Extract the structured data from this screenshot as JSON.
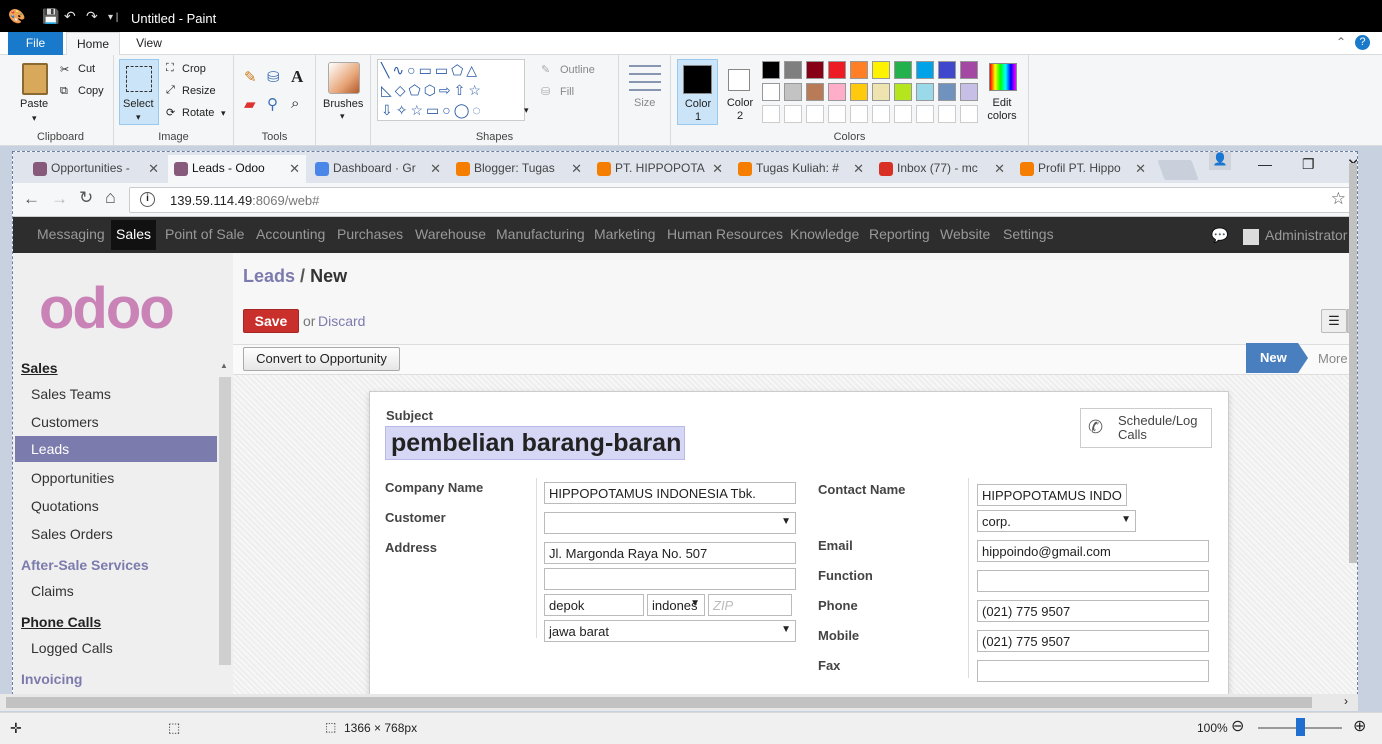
{
  "paint": {
    "title": "Untitled - Paint",
    "tabs": [
      "File",
      "Home",
      "View"
    ],
    "clipboard": {
      "paste": "Paste",
      "cut": "Cut",
      "copy": "Copy",
      "label": "Clipboard"
    },
    "image": {
      "select": "Select",
      "crop": "Crop",
      "resize": "Resize",
      "rotate": "Rotate",
      "label": "Image"
    },
    "tools": {
      "label": "Tools"
    },
    "brushes": "Brushes",
    "shapes": {
      "outline": "Outline",
      "fill": "Fill",
      "label": "Shapes"
    },
    "size": "Size",
    "color1": "Color 1",
    "color2": "Color 2",
    "colors_label": "Colors",
    "edit_colors": "Edit colors",
    "palette_row1": [
      "#000000",
      "#7f7f7f",
      "#880015",
      "#ed1c24",
      "#ff7f27",
      "#fff200",
      "#22b14c",
      "#00a2e8",
      "#3f48cc",
      "#a349a4"
    ],
    "palette_row2": [
      "#ffffff",
      "#c3c3c3",
      "#b97a57",
      "#ffaec9",
      "#ffc90e",
      "#efe4b0",
      "#b5e61d",
      "#99d9ea",
      "#7092be",
      "#c8bfe7"
    ],
    "status": {
      "dims": "1366 × 768px",
      "zoom": "100%"
    }
  },
  "browser": {
    "tabs": [
      {
        "label": "Opportunities -",
        "color": "#875a7b"
      },
      {
        "label": "Leads - Odoo",
        "color": "#875a7b"
      },
      {
        "label": "Dashboard · Gr",
        "color": "#4a86e8"
      },
      {
        "label": "Blogger: Tugas",
        "color": "#f57d00"
      },
      {
        "label": "PT. HIPPOPOTA",
        "color": "#f57d00"
      },
      {
        "label": "Tugas Kuliah: #",
        "color": "#f57d00"
      },
      {
        "label": "Inbox (77) - mc",
        "color": "#d93025"
      },
      {
        "label": "Profil PT. Hippo",
        "color": "#f57d00"
      }
    ],
    "url_host": "139.59.114.49",
    "url_rest": ":8069/web#"
  },
  "odoo": {
    "nav": [
      "Messaging",
      "Sales",
      "Point of Sale",
      "Accounting",
      "Purchases",
      "Warehouse",
      "Manufacturing",
      "Marketing",
      "Human Resources",
      "Knowledge",
      "Reporting",
      "Website",
      "Settings"
    ],
    "user": "Administrator",
    "logo": "odoo",
    "sidebar": {
      "sales": "Sales",
      "items": [
        "Sales Teams",
        "Customers",
        "Leads",
        "Opportunities",
        "Quotations",
        "Sales Orders"
      ],
      "after_sale": "After-Sale Services",
      "claims": "Claims",
      "phone_calls": "Phone Calls",
      "logged_calls": "Logged Calls",
      "invoicing": "Invoicing"
    },
    "breadcrumb_parent": "Leads",
    "breadcrumb_sep": "/",
    "breadcrumb_current": "New",
    "save": "Save",
    "or": "or",
    "discard": "Discard",
    "convert": "Convert to Opportunity",
    "stage_new": "New",
    "stage_more": "More",
    "form": {
      "subject_label": "Subject",
      "subject": "pembelian barang-baran",
      "schedule": "Schedule/Log Calls",
      "company_label": "Company Name",
      "company": "HIPPOPOTAMUS INDONESIA Tbk.",
      "customer_label": "Customer",
      "customer": "",
      "address_label": "Address",
      "street": "Jl. Margonda Raya No. 507",
      "street2": "",
      "city": "depok",
      "country": "indones",
      "zip_placeholder": "ZIP",
      "state": "jawa barat",
      "contact_label": "Contact Name",
      "contact": "HIPPOPOTAMUS INDO",
      "title": "corp.",
      "email_label": "Email",
      "email": "hippoindo@gmail.com",
      "function_label": "Function",
      "function": "",
      "phone_label": "Phone",
      "phone": "(021) 775 9507",
      "mobile_label": "Mobile",
      "mobile": "(021) 775 9507",
      "fax_label": "Fax",
      "fax": ""
    }
  }
}
